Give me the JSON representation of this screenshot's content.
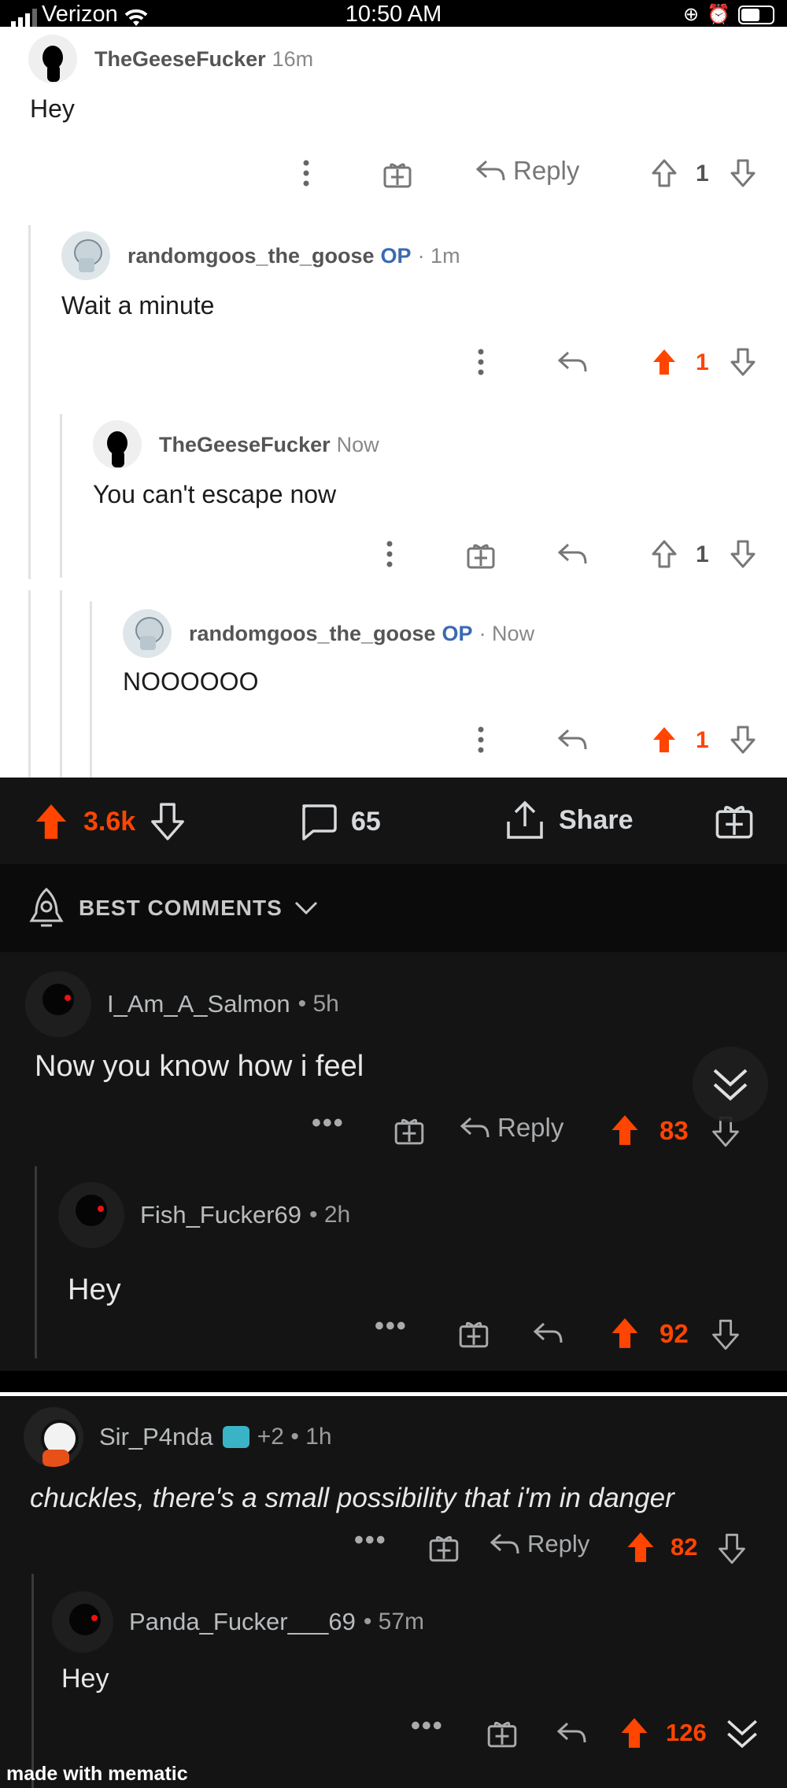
{
  "status_bar": {
    "carrier": "Verizon",
    "time": "10:50 AM"
  },
  "light_thread": {
    "comments": [
      {
        "username": "TheGeeseFucker",
        "op": "",
        "meta": "16m",
        "body": "Hey",
        "reply_label": "Reply",
        "score": "1",
        "upvoted": false
      },
      {
        "username": "randomgoos_the_goose",
        "op": "OP",
        "meta": "· 1m",
        "body": "Wait a minute",
        "reply_label": "",
        "score": "1",
        "upvoted": true
      },
      {
        "username": "TheGeeseFucker",
        "op": "",
        "meta": "Now",
        "body": "You can't escape now",
        "reply_label": "",
        "score": "1",
        "upvoted": false
      },
      {
        "username": "randomgoos_the_goose",
        "op": "OP",
        "meta": "· Now",
        "body": "NOOOOOO",
        "reply_label": "",
        "score": "1",
        "upvoted": true
      }
    ]
  },
  "post_bar": {
    "score": "3.6k",
    "comments": "65",
    "share_label": "Share"
  },
  "sort": {
    "label": "BEST COMMENTS"
  },
  "dark_thread": {
    "comments": [
      {
        "username": "I_Am_A_Salmon",
        "meta": "• 5h",
        "body": "Now you know how i feel",
        "reply_label": "Reply",
        "score": "83"
      },
      {
        "username": "Fish_Fucker69",
        "meta": "• 2h",
        "body": "Hey",
        "reply_label": "",
        "score": "92"
      },
      {
        "username": "Sir_P4nda",
        "meta": "+2 • 1h",
        "body": "chuckles, there's a small possibility that i'm in danger",
        "reply_label": "Reply",
        "score": "82"
      },
      {
        "username": "Panda_Fucker___69",
        "meta": "• 57m",
        "body": "Hey",
        "reply_label": "",
        "score": "126"
      }
    ]
  },
  "watermark": "made with mematic",
  "colors": {
    "upvote": "#ff4500",
    "op": "#3a6ab0",
    "dark_bg": "#141414"
  }
}
